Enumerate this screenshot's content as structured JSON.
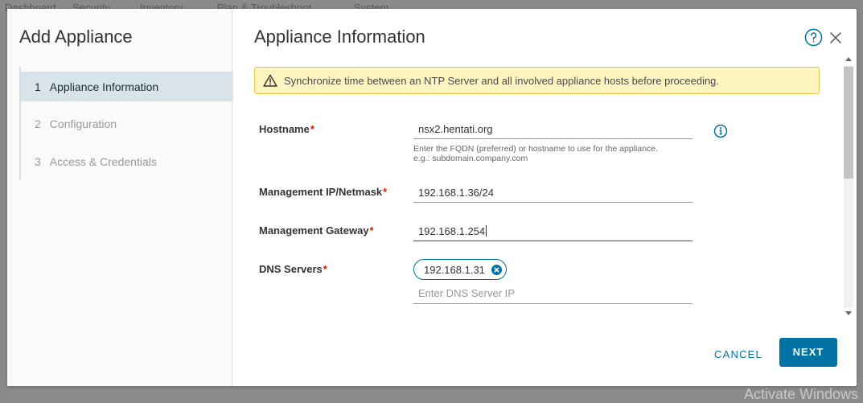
{
  "background": {
    "nav_items": [
      "Dashboard",
      "Security",
      "Inventory",
      "Plan & Troubleshoot",
      "System"
    ],
    "watermark": "Activate Windows"
  },
  "wizard": {
    "title": "Add Appliance",
    "steps": [
      {
        "num": "1",
        "label": "Appliance Information",
        "active": true
      },
      {
        "num": "2",
        "label": "Configuration",
        "active": false
      },
      {
        "num": "3",
        "label": "Access & Credentials",
        "active": false
      }
    ]
  },
  "content": {
    "title": "Appliance Information",
    "help_icon": "question-circle-icon",
    "close_icon": "close-icon",
    "alert": {
      "icon": "warning-triangle-icon",
      "text": "Synchronize time between an NTP Server and all involved appliance hosts before proceeding."
    },
    "form": {
      "hostname": {
        "label": "Hostname",
        "required": "*",
        "value": "nsx2.hentati.org",
        "helper_line1": "Enter the FQDN (preferred) or hostname to use for the appliance.",
        "helper_line2": "e.g.: subdomain.company.com"
      },
      "management_ip": {
        "label": "Management IP/Netmask",
        "required": "*",
        "value": "192.168.1.36/24"
      },
      "management_gateway": {
        "label": "Management Gateway",
        "required": "*",
        "value": "192.168.1.254"
      },
      "dns_servers": {
        "label": "DNS Servers",
        "required": "*",
        "chips": [
          "192.168.1.31"
        ],
        "placeholder": "Enter DNS Server IP"
      }
    }
  },
  "footer": {
    "cancel_label": "CANCEL",
    "next_label": "NEXT"
  },
  "colors": {
    "primary": "#0072a3",
    "required": "#c92100",
    "alert_bg": "#fdf4bf",
    "alert_border": "#e6c64a",
    "active_step_bg": "#d8e3ea"
  }
}
